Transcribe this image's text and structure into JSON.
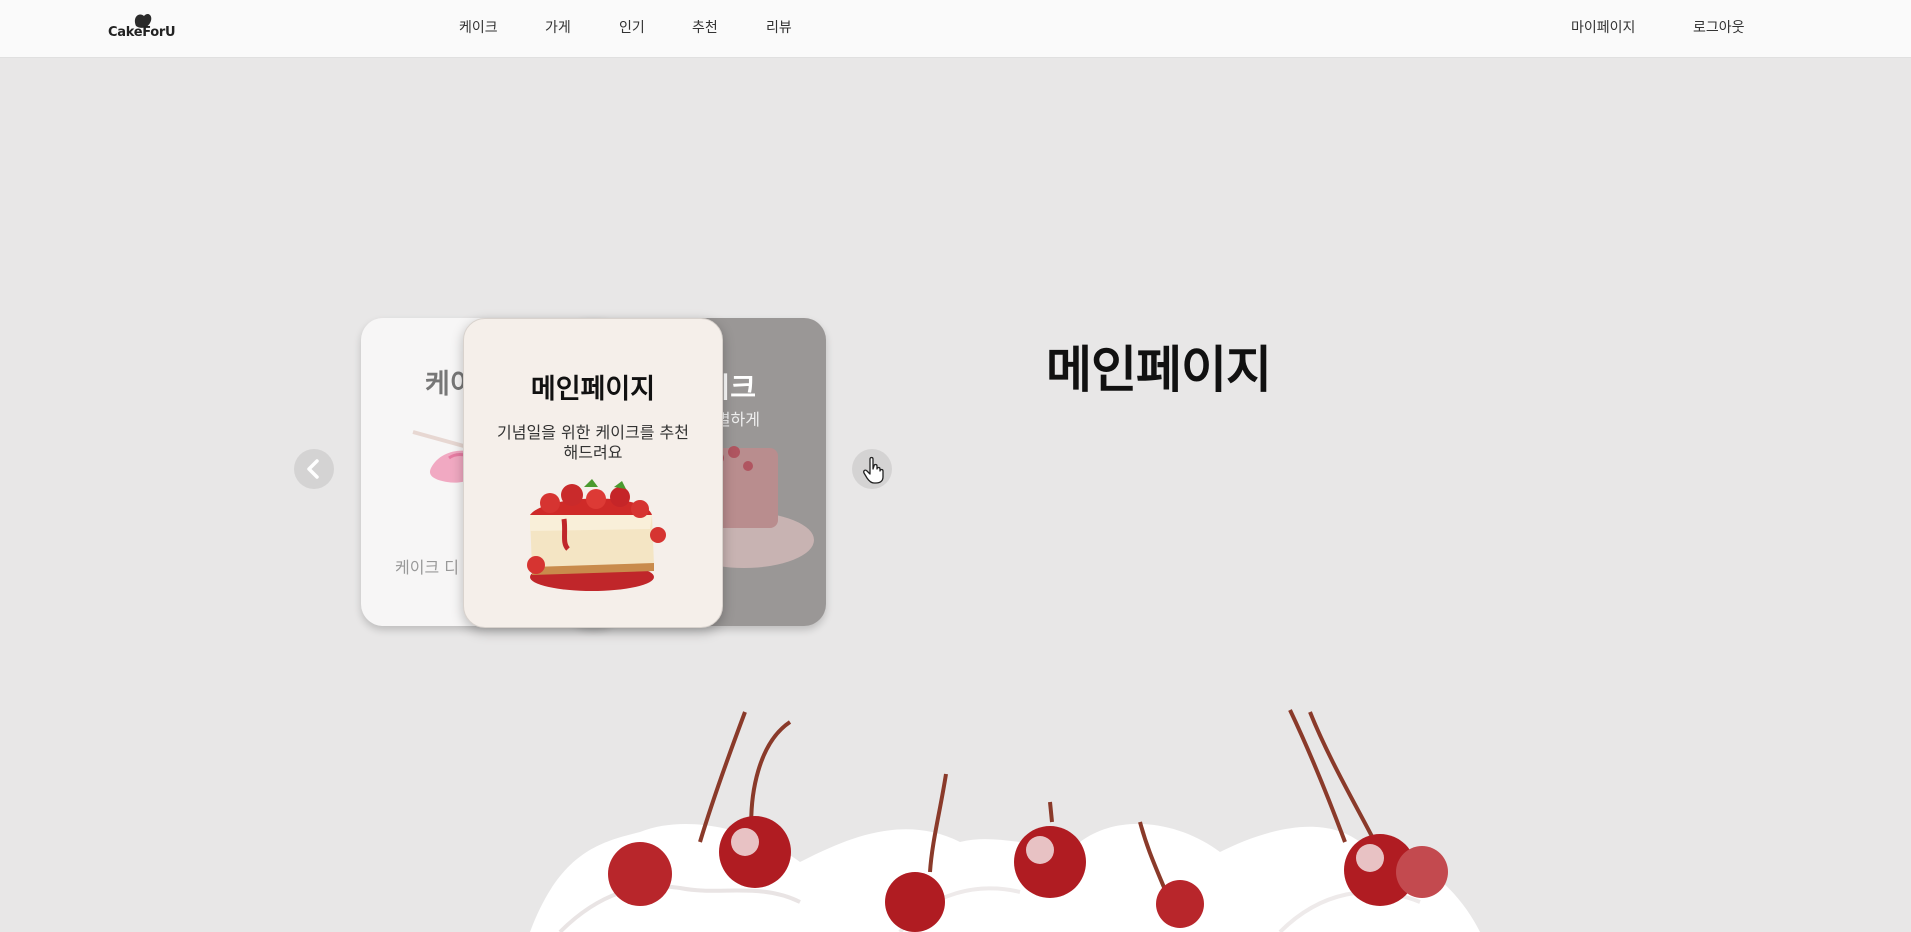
{
  "header": {
    "logo_text": "CakeForU",
    "nav": [
      {
        "label": "케이크"
      },
      {
        "label": "가게"
      },
      {
        "label": "인기"
      },
      {
        "label": "추천"
      },
      {
        "label": "리뷰"
      }
    ],
    "mypage_label": "마이페이지",
    "logout_label": "로그아웃"
  },
  "hero": {
    "title": "메인페이지"
  },
  "carousel": {
    "left_card": {
      "title": "케이",
      "desc": "케이크 디"
    },
    "center_card": {
      "title": "메인페이지",
      "desc": "기념일을 위한 케이크를 추천해드려요"
    },
    "right_card": {
      "title": "이크",
      "desc": "특별하게"
    },
    "prev_icon": "chevron-left-icon",
    "next_icon": "chevron-right-icon"
  },
  "colors": {
    "background": "#e8e7e7",
    "header": "#fafafa",
    "center_card": "#f5efea",
    "cherry": "#b01c22",
    "cream": "#ffffff"
  }
}
